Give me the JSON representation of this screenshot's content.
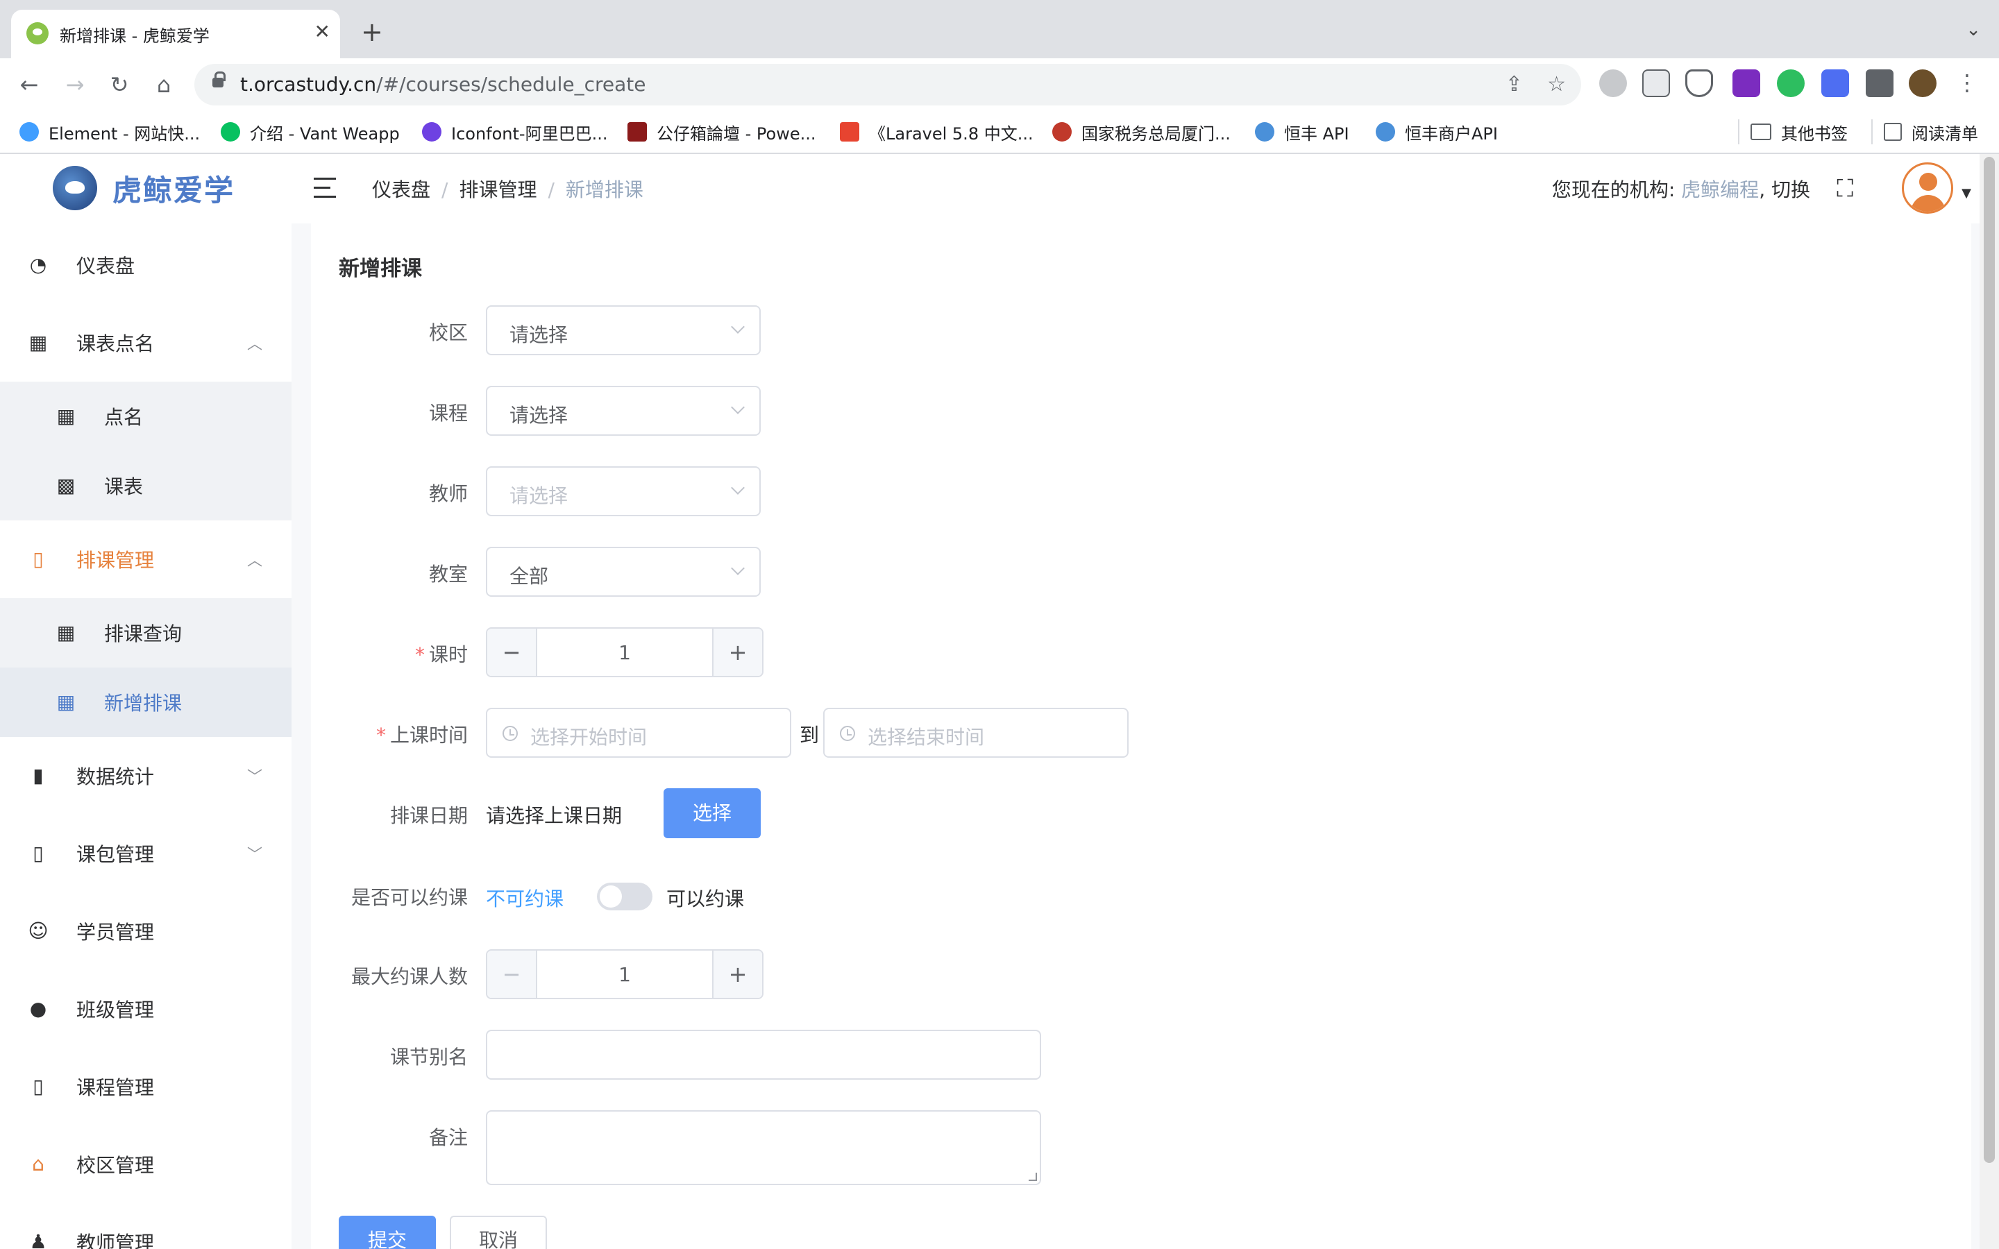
{
  "browser": {
    "tab_title": "新增排课 - 虎鲸爱学",
    "url_host": "t.orcastudy.cn",
    "url_path": "/#/courses/schedule_create",
    "bookmarks": [
      {
        "label": "Element - 网站快...",
        "color": "#409eff"
      },
      {
        "label": "介绍 - Vant Weapp",
        "color": "#07c160"
      },
      {
        "label": "Iconfont-阿里巴巴...",
        "color": "#6e41e2"
      },
      {
        "label": "公仔箱論壇 - Powe...",
        "color": "#8b1a1a"
      },
      {
        "label": "《Laravel 5.8 中文...",
        "color": "#e74430"
      },
      {
        "label": "国家税务总局厦门...",
        "color": "#c0392b"
      },
      {
        "label": "恒丰 API",
        "color": "#4a90d9"
      },
      {
        "label": "恒丰商户API",
        "color": "#4a90d9"
      }
    ],
    "other_bookmarks": "其他书签",
    "reading_list": "阅读清单"
  },
  "app": {
    "logo_text": "虎鲸爱学",
    "breadcrumb": [
      "仪表盘",
      "排课管理",
      "新增排课"
    ],
    "org_prefix": "您现在的机构: ",
    "org_name": "虎鲸编程",
    "org_switch": ", 切换"
  },
  "sidebar": {
    "items": [
      {
        "label": "仪表盘",
        "icon": "dashboard-icon"
      },
      {
        "label": "课表点名",
        "icon": "calendar-icon",
        "expanded": true,
        "children": [
          {
            "label": "点名",
            "icon": "calendar-check-icon"
          },
          {
            "label": "课表",
            "icon": "table-icon"
          }
        ]
      },
      {
        "label": "排课管理",
        "icon": "book-icon",
        "expanded": true,
        "active": true,
        "children": [
          {
            "label": "排课查询",
            "icon": "calendar-icon"
          },
          {
            "label": "新增排课",
            "icon": "calendar-icon",
            "selected": true
          }
        ]
      },
      {
        "label": "数据统计",
        "icon": "bar-chart-icon"
      },
      {
        "label": "课包管理",
        "icon": "book-icon"
      },
      {
        "label": "学员管理",
        "icon": "student-icon"
      },
      {
        "label": "班级管理",
        "icon": "users-icon"
      },
      {
        "label": "课程管理",
        "icon": "book-icon"
      },
      {
        "label": "校区管理",
        "icon": "school-icon"
      },
      {
        "label": "教师管理",
        "icon": "teacher-icon"
      }
    ]
  },
  "form": {
    "title": "新增排课",
    "campus": {
      "label": "校区",
      "value": "请选择"
    },
    "course": {
      "label": "课程",
      "value": "请选择"
    },
    "teacher": {
      "label": "教师",
      "placeholder": "请选择"
    },
    "classroom": {
      "label": "教室",
      "value": "全部"
    },
    "hours": {
      "label": "课时",
      "value": "1"
    },
    "time": {
      "label": "上课时间",
      "start_placeholder": "选择开始时间",
      "end_placeholder": "选择结束时间",
      "separator": "到"
    },
    "date": {
      "label": "排课日期",
      "hint": "请选择上课日期",
      "button": "选择"
    },
    "bookable": {
      "label": "是否可以约课",
      "off_text": "不可约课",
      "on_text": "可以约课",
      "on": false
    },
    "max_people": {
      "label": "最大约课人数",
      "value": "1"
    },
    "alias": {
      "label": "课节别名",
      "value": ""
    },
    "remark": {
      "label": "备注",
      "value": ""
    },
    "submit": "提交",
    "cancel": "取消"
  },
  "colors": {
    "accent": "#e6813c",
    "primary": "#5b95f7",
    "link": "#409eff",
    "required": "#f56c6c"
  }
}
